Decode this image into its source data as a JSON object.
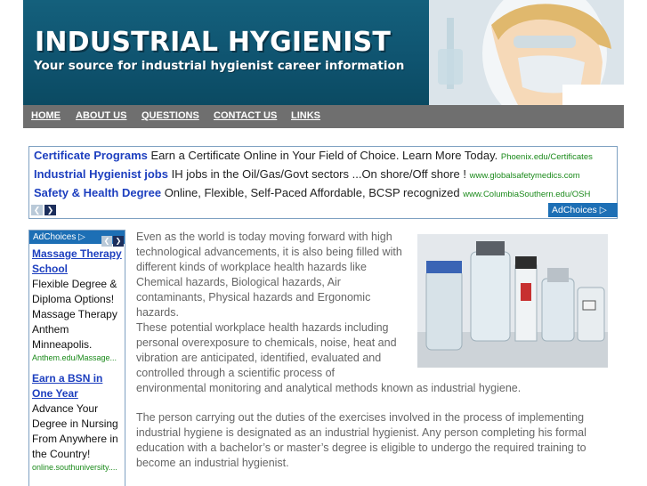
{
  "header": {
    "title": "INDUSTRIAL HYGIENIST",
    "tagline": "Your source for industrial hygienist career information"
  },
  "nav": {
    "items": [
      "HOME",
      "ABOUT US",
      "QUESTIONS",
      "CONTACT US",
      "LINKS"
    ]
  },
  "top_ads": {
    "items": [
      {
        "title": "Certificate Programs",
        "body": "Earn a Certificate Online in Your Field of Choice. Learn More Today.",
        "url": "Phoenix.edu/Certificates"
      },
      {
        "title": "Industrial Hygienist jobs",
        "body": "IH jobs in the Oil/Gas/Govt sectors ...On shore/Off shore !",
        "url": "www.globalsafetymedics.com"
      },
      {
        "title": "Safety & Health Degree",
        "body": "Online, Flexible, Self-Paced Affordable, BCSP recognized",
        "url": "www.ColumbiaSouthern.edu/OSH"
      }
    ],
    "adchoices": "AdChoices",
    "prev_glyph": "❮",
    "next_glyph": "❯"
  },
  "side_ads": {
    "adchoices": "AdChoices",
    "items": [
      {
        "title": "Massage Therapy School",
        "body": "Flexible Degree & Diploma Options! Massage Therapy Anthem Minneapolis.",
        "url": "Anthem.edu/Massage..."
      },
      {
        "title": "Earn a BSN in One Year",
        "body": "Advance Your Degree in Nursing From Anywhere in the Country!",
        "url": "online.southuniversity...."
      }
    ]
  },
  "content": {
    "para1": "Even as the world is today moving forward with high technological advancements, it is also being filled with different kinds of workplace health hazards like Chemical hazards, Biological hazards, Air contaminants, Physical hazards and Ergonomic hazards.",
    "para1b": "These potential workplace health hazards including personal overexposure to chemicals, noise, heat and vibration are anticipated, identified, evaluated and controlled through a scientific process of",
    "para1c": "environmental monitoring and analytical methods known as industrial hygiene.",
    "para2": "The person carrying out the duties of the exercises involved in the process of implementing industrial hygiene is designated as an industrial hygienist. Any person completing his formal education with a bachelor’s or master’s degree is eligible to undergo the required training to become an industrial hygienist."
  },
  "icons": {
    "header_photo": "scientist-photo",
    "lab_photo": "lab-bottles-photo"
  },
  "colors": {
    "header_bg": "#0f5470",
    "nav_bg": "#6f6f6f",
    "ad_title": "#1d3fbf",
    "ad_url": "#1b8a1b",
    "adchoices_bg": "#1d6fb5",
    "body_text": "#666666"
  }
}
